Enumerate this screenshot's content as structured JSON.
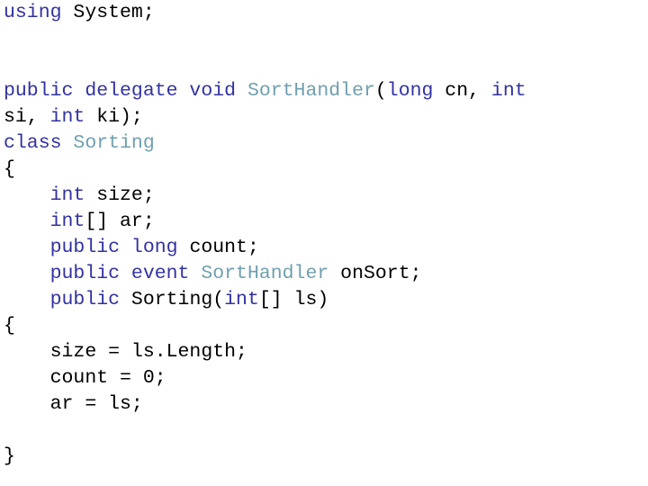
{
  "slide": {
    "kind": "code-listing-slide",
    "background_color": "#ffffff",
    "language": "C#"
  },
  "theme": {
    "keyword_color": "#3232a0",
    "type_color": "#6f9fae",
    "plain_color": "#000000",
    "background_color": "#ffffff"
  },
  "code": {
    "full_text": "using System;\n\n\npublic delegate void SortHandler(long cn, int si, int ki);\nclass Sorting\n{\n    int size;\n    int[] ar;\n    public long count;\n    public event SortHandler onSort;\n    public Sorting(int[] ls)\n{\n    size = ls.Length;\n    count = 0;\n    ar = ls;\n\n}",
    "lines": [
      {
        "index": 0,
        "text": "using System;",
        "tokens": [
          {
            "t": "using",
            "c": "keyword"
          },
          {
            "t": " System;",
            "c": "plain"
          }
        ]
      },
      {
        "index": 1,
        "text": "",
        "tokens": []
      },
      {
        "index": 2,
        "text": "",
        "tokens": []
      },
      {
        "index": 3,
        "text": "public delegate void SortHandler(long cn, int",
        "tokens": [
          {
            "t": "public delegate void ",
            "c": "keyword"
          },
          {
            "t": "SortHandler",
            "c": "type"
          },
          {
            "t": "(",
            "c": "plain"
          },
          {
            "t": "long",
            "c": "keyword"
          },
          {
            "t": " cn, ",
            "c": "plain"
          },
          {
            "t": "int",
            "c": "keyword"
          }
        ]
      },
      {
        "index": 4,
        "text": "si, int ki);",
        "tokens": [
          {
            "t": "si, ",
            "c": "plain"
          },
          {
            "t": "int",
            "c": "keyword"
          },
          {
            "t": " ki);",
            "c": "plain"
          }
        ]
      },
      {
        "index": 5,
        "text": "class Sorting",
        "tokens": [
          {
            "t": "class",
            "c": "keyword"
          },
          {
            "t": " ",
            "c": "plain"
          },
          {
            "t": "Sorting",
            "c": "type"
          }
        ]
      },
      {
        "index": 6,
        "text": "{",
        "tokens": [
          {
            "t": "{",
            "c": "plain"
          }
        ]
      },
      {
        "index": 7,
        "text": "    int size;",
        "tokens": [
          {
            "t": "    ",
            "c": "plain"
          },
          {
            "t": "int",
            "c": "keyword"
          },
          {
            "t": " size;",
            "c": "plain"
          }
        ]
      },
      {
        "index": 8,
        "text": "    int[] ar;",
        "tokens": [
          {
            "t": "    ",
            "c": "plain"
          },
          {
            "t": "int",
            "c": "keyword"
          },
          {
            "t": "[] ar;",
            "c": "plain"
          }
        ]
      },
      {
        "index": 9,
        "text": "    public long count;",
        "tokens": [
          {
            "t": "    ",
            "c": "plain"
          },
          {
            "t": "public long",
            "c": "keyword"
          },
          {
            "t": " count;",
            "c": "plain"
          }
        ]
      },
      {
        "index": 10,
        "text": "    public event SortHandler onSort;",
        "tokens": [
          {
            "t": "    ",
            "c": "plain"
          },
          {
            "t": "public event ",
            "c": "keyword"
          },
          {
            "t": "SortHandler",
            "c": "type"
          },
          {
            "t": " onSort;",
            "c": "plain"
          }
        ]
      },
      {
        "index": 11,
        "text": "    public Sorting(int[] ls)",
        "tokens": [
          {
            "t": "    ",
            "c": "plain"
          },
          {
            "t": "public",
            "c": "keyword"
          },
          {
            "t": " Sorting(",
            "c": "plain"
          },
          {
            "t": "int",
            "c": "keyword"
          },
          {
            "t": "[] ls)",
            "c": "plain"
          }
        ]
      },
      {
        "index": 12,
        "text": "{",
        "tokens": [
          {
            "t": "{",
            "c": "plain"
          }
        ]
      },
      {
        "index": 13,
        "text": "    size = ls.Length;",
        "tokens": [
          {
            "t": "    size = ls.Length;",
            "c": "plain"
          }
        ]
      },
      {
        "index": 14,
        "text": "    count = 0;",
        "tokens": [
          {
            "t": "    count = 0;",
            "c": "plain"
          }
        ]
      },
      {
        "index": 15,
        "text": "    ar = ls;",
        "tokens": [
          {
            "t": "    ar = ls;",
            "c": "plain"
          }
        ]
      },
      {
        "index": 16,
        "text": "",
        "tokens": []
      },
      {
        "index": 17,
        "text": "}",
        "tokens": [
          {
            "t": "}",
            "c": "plain"
          }
        ]
      }
    ]
  }
}
